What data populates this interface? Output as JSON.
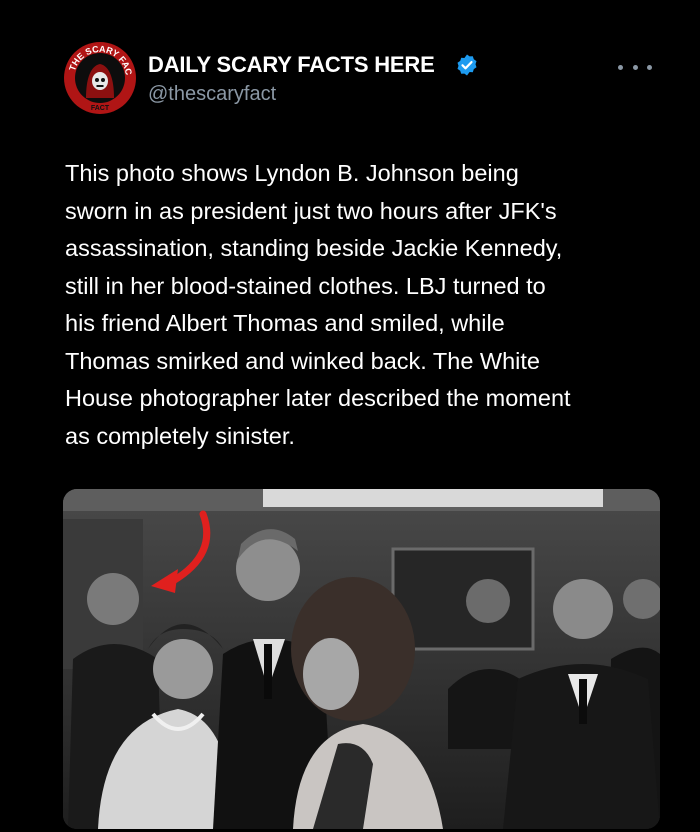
{
  "account": {
    "display_name": "DAILY SCARY FACTS HERE",
    "handle": "@thescaryfact",
    "verified": true,
    "avatar_icon": "skull-logo-icon",
    "avatar_ring_text": "THE SCARY FACT"
  },
  "more_icon": "more-horizontal-icon",
  "tweet": {
    "text": "This photo shows Lyndon B. Johnson being\nsworn in as president just two hours after JFK's\nassassination, standing beside Jackie Kennedy,\nstill in her blood-stained clothes. LBJ turned to\nhis friend Albert Thomas and smiled, while\nThomas smirked and winked back. The White\nHouse photographer later described the moment\nas completely sinister."
  },
  "media": {
    "annotation": "red-arrow-icon"
  },
  "colors": {
    "background": "#000000",
    "text": "#ffffff",
    "secondary_text": "#8b98a5",
    "verified_badge": "#1d9bf0",
    "arrow": "#e0201e"
  }
}
